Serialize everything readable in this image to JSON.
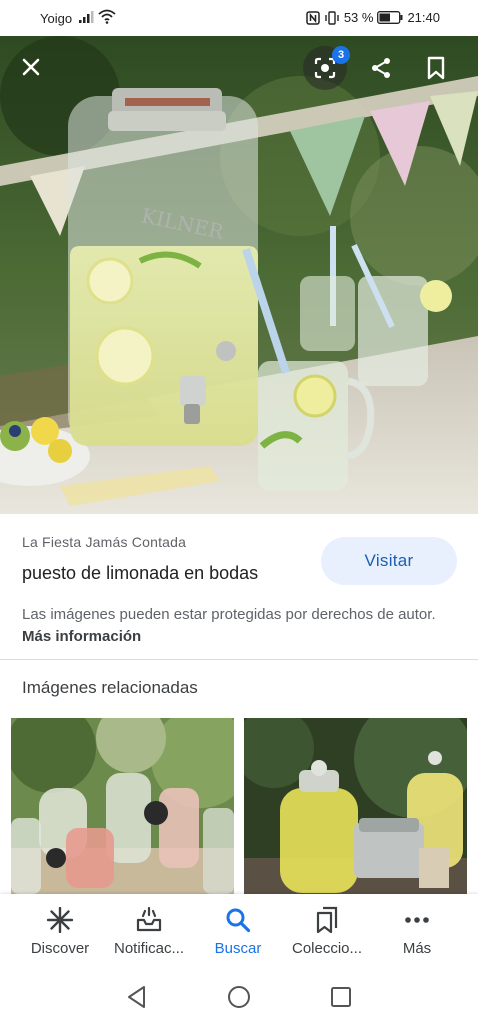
{
  "status_bar": {
    "carrier": "Yoigo",
    "battery_text": "53 %",
    "time": "21:40"
  },
  "hero": {
    "lens_badge": "3",
    "icons": [
      "close-icon",
      "lens-icon",
      "share-icon",
      "bookmark-icon"
    ]
  },
  "result": {
    "source": "La Fiesta Jamás Contada",
    "title": "puesto de limonada en bodas",
    "visit_label": "Visitar",
    "copyright_text": "Las imágenes pueden estar protegidas por derechos de autor.",
    "more_info": "Más información"
  },
  "related": {
    "title": "Imágenes relacionadas"
  },
  "bottom_nav": {
    "items": [
      {
        "label": "Discover",
        "icon": "asterisk-icon"
      },
      {
        "label": "Notificac...",
        "icon": "inbox-icon"
      },
      {
        "label": "Buscar",
        "icon": "search-icon"
      },
      {
        "label": "Coleccio...",
        "icon": "collections-icon"
      },
      {
        "label": "Más",
        "icon": "more-icon"
      }
    ],
    "active_color": "#1a73e8"
  },
  "colors": {
    "accent": "#1a73e8",
    "visit_bg": "#e8f0fe"
  }
}
